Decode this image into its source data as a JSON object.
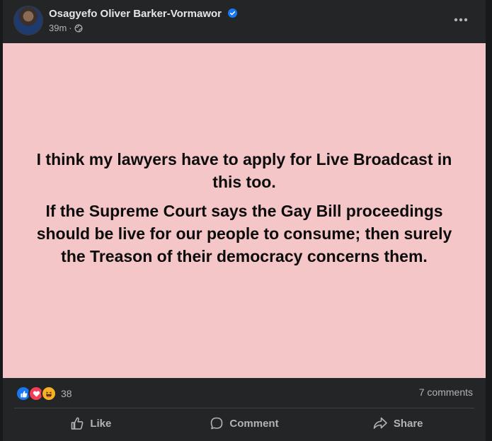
{
  "post": {
    "author": "Osagyefo Oliver Barker-Vormawor",
    "time": "39m",
    "separator": "·",
    "paragraphs": [
      "I think my lawyers have to apply for Live Broadcast in this too.",
      "If the Supreme Court says the Gay Bill proceedings should be live for our people to consume; then surely the Treason of their democracy concerns them."
    ],
    "background_color": "#f5c6c7"
  },
  "stats": {
    "reaction_count": "38",
    "reactions": [
      "like-icon",
      "love-icon",
      "haha-icon"
    ],
    "comments": "7 comments"
  },
  "actions": {
    "like": "Like",
    "comment": "Comment",
    "share": "Share"
  },
  "colors": {
    "card": "#242526",
    "accent": "#1877f2",
    "muted_text": "#b0b3b8"
  }
}
